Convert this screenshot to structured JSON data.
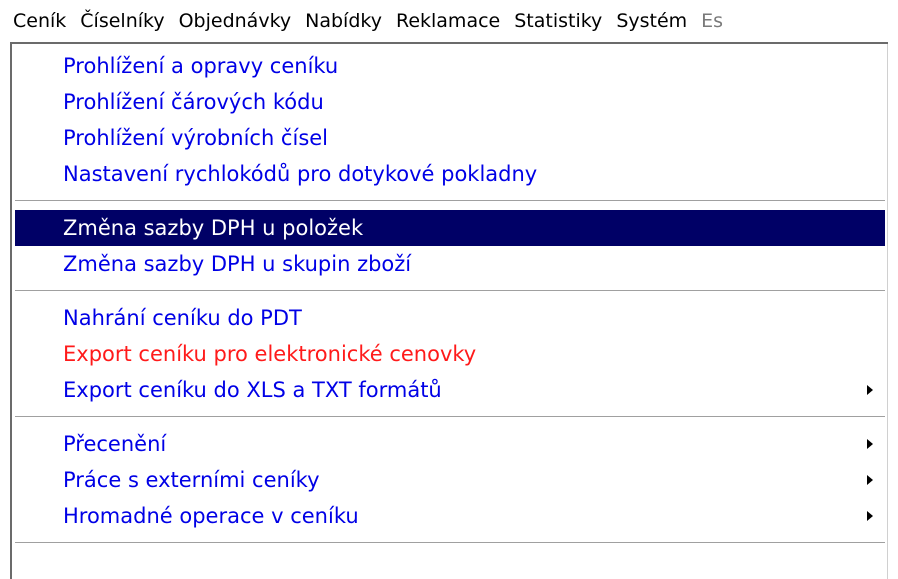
{
  "menubar": {
    "items": [
      {
        "label": "Ceník"
      },
      {
        "label": "Číselníky"
      },
      {
        "label": "Objednávky"
      },
      {
        "label": "Nabídky"
      },
      {
        "label": "Reklamace"
      },
      {
        "label": "Statistiky"
      },
      {
        "label": "Systém"
      },
      {
        "label": "Es"
      }
    ]
  },
  "dropdown": {
    "groups": [
      {
        "items": [
          {
            "label": "Prohlížení a opravy ceníku"
          },
          {
            "label": "Prohlížení čárových kódu"
          },
          {
            "label": "Prohlížení výrobních čísel"
          },
          {
            "label": "Nastavení rychlokódů pro dotykové pokladny"
          }
        ]
      },
      {
        "items": [
          {
            "label": "Změna sazby DPH u položek",
            "selected": true
          },
          {
            "label": "Změna sazby DPH u skupin zboží"
          }
        ]
      },
      {
        "items": [
          {
            "label": "Nahrání ceníku do PDT"
          },
          {
            "label": "Export ceníku pro elektronické cenovky",
            "color": "red"
          },
          {
            "label": "Export ceníku do XLS a TXT formátů",
            "submenu_icon": "triangle-right-icon"
          }
        ]
      },
      {
        "items": [
          {
            "label": "Přecenění",
            "submenu_icon": "triangle-right-icon"
          },
          {
            "label": "Práce s externími ceníky",
            "submenu_icon": "triangle-right-icon"
          },
          {
            "label": "Hromadné operace v ceníku",
            "submenu_icon": "triangle-right-icon"
          }
        ]
      }
    ]
  },
  "colors": {
    "item_text": "#0000e6",
    "highlight_bg": "#000066",
    "highlight_text": "#ffffff",
    "warning_text": "#ff1a1a"
  }
}
